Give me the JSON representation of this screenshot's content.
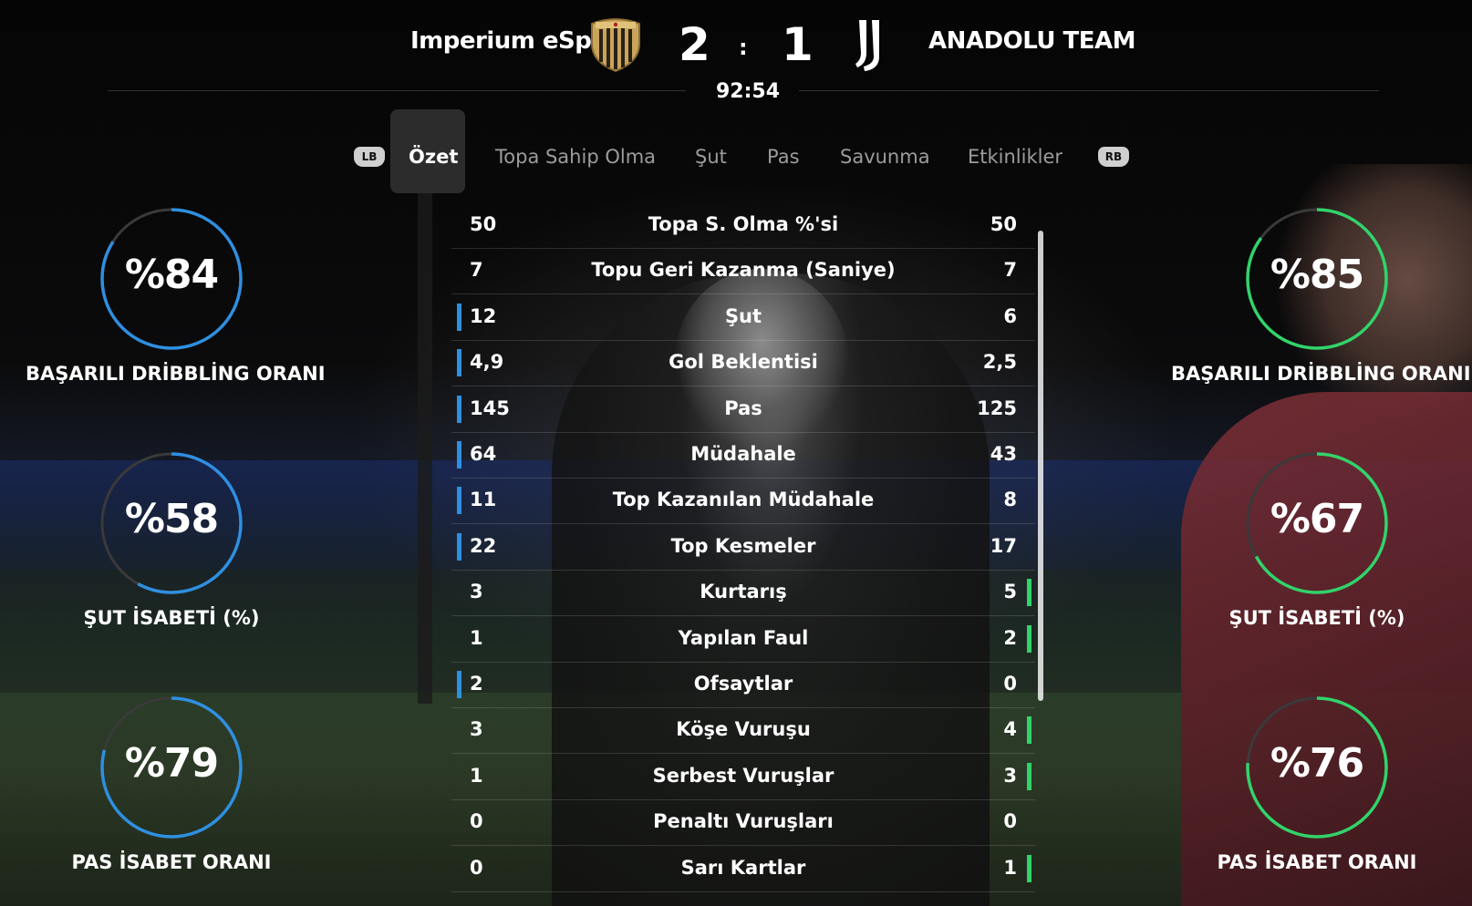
{
  "header": {
    "home_team": "Imperium eSp",
    "away_team": "ANADOLU TEAM",
    "home_score": "2",
    "away_score": "1",
    "score_separator": ":",
    "clock": "92:54"
  },
  "tabs": {
    "left_bumper": "LB",
    "right_bumper": "RB",
    "items": [
      "Özet",
      "Topa Sahip Olma",
      "Şut",
      "Pas",
      "Savunma",
      "Etkinlikler"
    ],
    "active": "Özet"
  },
  "stats": [
    {
      "label": "Topa S. Olma %'si",
      "home": "50",
      "away": "50",
      "lead": ""
    },
    {
      "label": "Topu Geri Kazanma (Saniye)",
      "home": "7",
      "away": "7",
      "lead": ""
    },
    {
      "label": "Şut",
      "home": "12",
      "away": "6",
      "lead": "home"
    },
    {
      "label": "Gol Beklentisi",
      "home": "4,9",
      "away": "2,5",
      "lead": "home"
    },
    {
      "label": "Pas",
      "home": "145",
      "away": "125",
      "lead": "home"
    },
    {
      "label": "Müdahale",
      "home": "64",
      "away": "43",
      "lead": "home"
    },
    {
      "label": "Top Kazanılan Müdahale",
      "home": "11",
      "away": "8",
      "lead": "home"
    },
    {
      "label": "Top Kesmeler",
      "home": "22",
      "away": "17",
      "lead": "home"
    },
    {
      "label": "Kurtarış",
      "home": "3",
      "away": "5",
      "lead": "away"
    },
    {
      "label": "Yapılan Faul",
      "home": "1",
      "away": "2",
      "lead": "away"
    },
    {
      "label": "Ofsaytlar",
      "home": "2",
      "away": "0",
      "lead": "home"
    },
    {
      "label": "Köşe Vuruşu",
      "home": "3",
      "away": "4",
      "lead": "away"
    },
    {
      "label": "Serbest Vuruşlar",
      "home": "1",
      "away": "3",
      "lead": "away"
    },
    {
      "label": "Penaltı Vuruşları",
      "home": "0",
      "away": "0",
      "lead": ""
    },
    {
      "label": "Sarı Kartlar",
      "home": "0",
      "away": "1",
      "lead": "away"
    }
  ],
  "rings": {
    "home": [
      {
        "value": "%84",
        "percent": 84,
        "label": "BAŞARILI DRİBBLİNG ORANI"
      },
      {
        "value": "%58",
        "percent": 58,
        "label": "ŞUT İSABETİ (%)"
      },
      {
        "value": "%79",
        "percent": 79,
        "label": "PAS İSABET ORANI"
      }
    ],
    "away": [
      {
        "value": "%85",
        "percent": 85,
        "label": "BAŞARILI DRİBBLİNG ORANI"
      },
      {
        "value": "%67",
        "percent": 67,
        "label": "ŞUT İSABETİ (%)"
      },
      {
        "value": "%76",
        "percent": 76,
        "label": "PAS İSABET ORANI"
      }
    ]
  },
  "colors": {
    "home_accent": "#2f8fe0",
    "away_accent": "#32d36a",
    "ring_track": "#3a3a3a"
  },
  "icons": {
    "home_crest": "striped-shield-crest-icon",
    "away_crest": "juventus-j-crest-icon"
  }
}
